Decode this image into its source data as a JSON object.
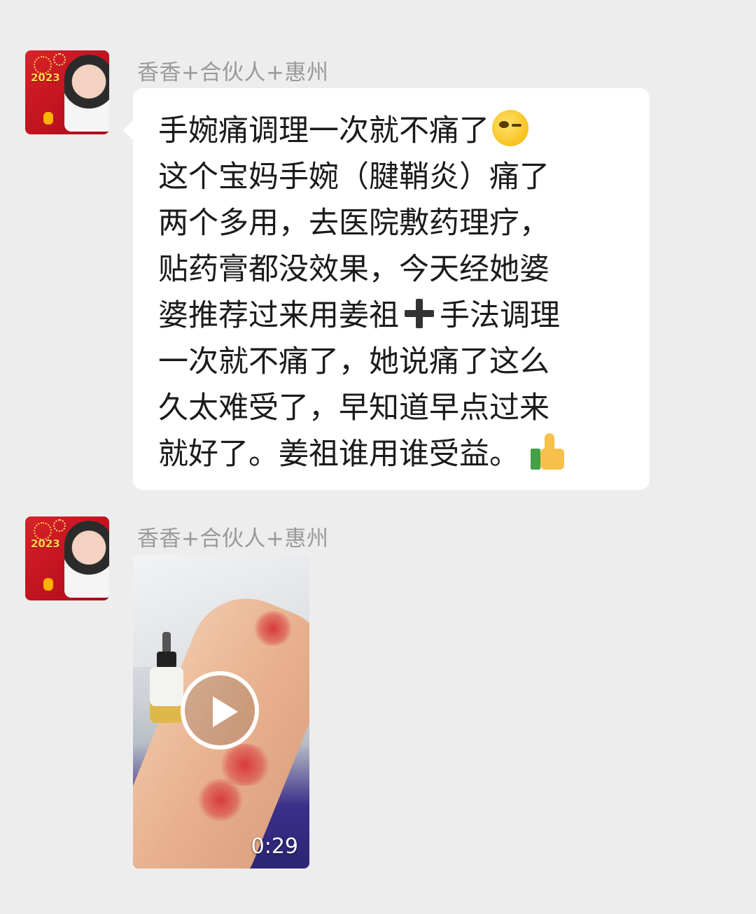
{
  "messages": [
    {
      "sender": "香香+合伙人+惠州",
      "avatar_icon": "avatar-2023-new-year",
      "type": "text",
      "lines": [
        "手婉痛调理一次就不痛了",
        "这个宝妈手婉（腱鞘炎）痛了",
        "两个多用，去医院敷药理疗，",
        "贴药膏都没效果，今天经她婆",
        "婆推荐过来用姜祖",
        "手法调理",
        "一次就不痛了，她说痛了这么",
        "久太难受了，早知道早点过来",
        "就好了。姜祖谁用谁受益。"
      ],
      "avatar_text": "2023",
      "emojis": [
        "wink-emoji",
        "heavy-plus-icon",
        "thumbs-up-emoji"
      ]
    },
    {
      "sender": "香香+合伙人+惠州",
      "avatar_icon": "avatar-2023-new-year",
      "avatar_text": "2023",
      "type": "video",
      "duration": "0:29"
    }
  ],
  "colors": {
    "background": "#ededed",
    "bubble": "#ffffff",
    "sender_text": "#9a9a9a",
    "message_text": "#1b1b1b"
  }
}
